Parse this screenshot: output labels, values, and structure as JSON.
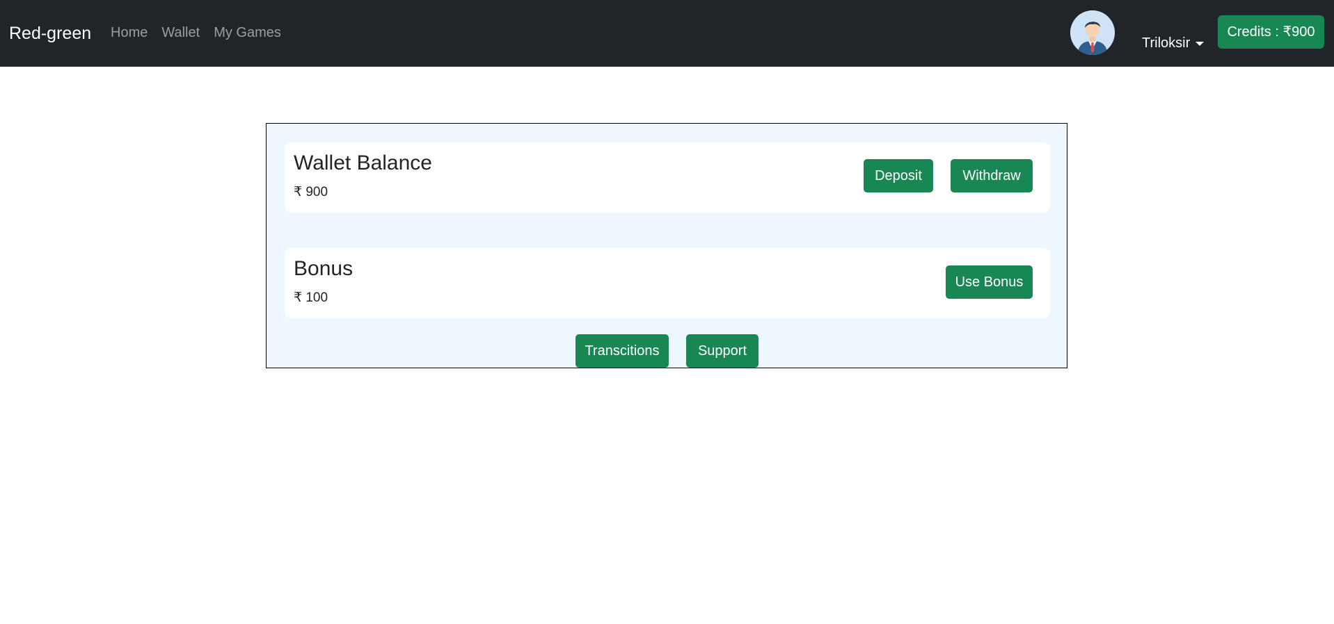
{
  "navbar": {
    "brand": "Red-green",
    "links": [
      "Home",
      "Wallet",
      "My Games"
    ],
    "user_name": "Triloksir",
    "credits_label": "Credits : ₹900"
  },
  "wallet": {
    "title": "Wallet Balance",
    "amount": "₹ 900",
    "deposit_label": "Deposit",
    "withdraw_label": "Withdraw"
  },
  "bonus": {
    "title": "Bonus",
    "amount": "₹ 100",
    "use_bonus_label": "Use Bonus"
  },
  "footer_actions": {
    "transactions_label": "Transcitions",
    "support_label": "Support"
  },
  "colors": {
    "navbar_bg": "#212529",
    "accent_green": "#198754",
    "panel_bg": "#eef6fe"
  },
  "icons": {
    "avatar": "user-avatar-businessman"
  }
}
